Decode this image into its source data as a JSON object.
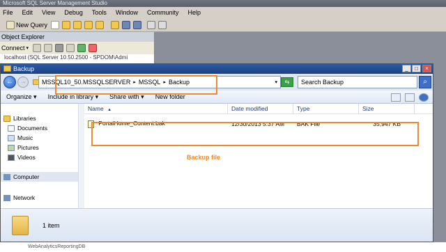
{
  "ssms": {
    "title": "Microsoft SQL Server Management Studio",
    "menu": [
      "File",
      "Edit",
      "View",
      "Debug",
      "Tools",
      "Window",
      "Community",
      "Help"
    ],
    "new_query": "New Query"
  },
  "object_explorer": {
    "title": "Object Explorer",
    "connect": "Connect",
    "server_node": "localhost (SQL Server 10.50.2500 - SPDOM\\Admi"
  },
  "explorer": {
    "title": "Backup",
    "address": [
      "MSSQL10_50.MSSQLSERVER",
      "MSSQL",
      "Backup"
    ],
    "search_placeholder": "Search Backup",
    "commands": [
      "Organize",
      "Include in library",
      "Share with",
      "New folder"
    ],
    "nav": {
      "libraries": "Libraries",
      "items": [
        "Documents",
        "Music",
        "Pictures",
        "Videos"
      ],
      "computer": "Computer",
      "network": "Network"
    },
    "columns": [
      "Name",
      "Date modified",
      "Type",
      "Size"
    ],
    "files": [
      {
        "name": "PortalHome_Content.bak",
        "modified": "12/30/2013 5:37 AM",
        "type": "BAK File",
        "size": "35,947 KB"
      }
    ],
    "status": "1 item"
  },
  "annotation": {
    "label": "Backup file",
    "color": "#f0892a"
  },
  "bottom_text": "WebAnalyticsReportingDB"
}
